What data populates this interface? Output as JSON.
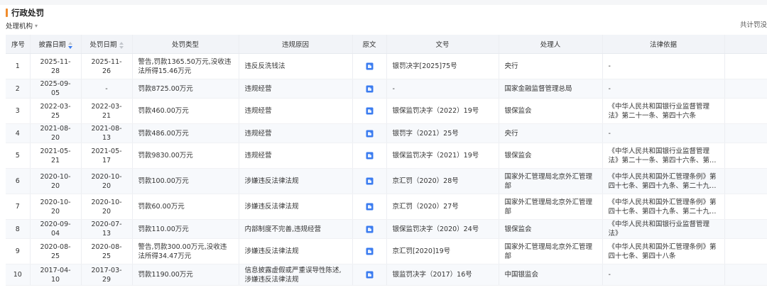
{
  "section": {
    "title": "行政处罚"
  },
  "filter": {
    "label": "处理机构"
  },
  "total_text": "共计罚没",
  "columns": {
    "idx": "序号",
    "disclose_date": "披露日期",
    "penalty_date": "处罚日期",
    "penalty_type": "处罚类型",
    "reason": "违规原因",
    "original": "原文",
    "doc_no": "文号",
    "handler": "处理人",
    "law": "法律依据"
  },
  "rows": [
    {
      "idx": "1",
      "disclose_date": "2025-11-28",
      "penalty_date": "2025-11-26",
      "penalty_type": "警告,罚款1365.50万元,没收违法所得15.46万元",
      "reason": "违反反洗钱法",
      "doc_no": "银罚决字[2025]75号",
      "handler": "央行",
      "law": "-"
    },
    {
      "idx": "2",
      "disclose_date": "2025-09-05",
      "penalty_date": "-",
      "penalty_type": "罚款8725.00万元",
      "reason": "违规经营",
      "doc_no": "-",
      "handler": "国家金融监督管理总局",
      "law": "-"
    },
    {
      "idx": "3",
      "disclose_date": "2022-03-25",
      "penalty_date": "2022-03-21",
      "penalty_type": "罚款460.00万元",
      "reason": "违规经营",
      "doc_no": "银保监罚决字（2022）19号",
      "handler": "银保监会",
      "law": "《中华人民共和国银行业监督管理法》第二十一条、第四十六条"
    },
    {
      "idx": "4",
      "disclose_date": "2021-08-20",
      "penalty_date": "2021-08-13",
      "penalty_type": "罚款486.00万元",
      "reason": "违规经营",
      "doc_no": "银罚字（2021）25号",
      "handler": "央行",
      "law": "-"
    },
    {
      "idx": "5",
      "disclose_date": "2021-05-21",
      "penalty_date": "2021-05-17",
      "penalty_type": "罚款9830.00万元",
      "reason": "违规经营",
      "doc_no": "银保监罚决字（2021）19号",
      "handler": "银保监会",
      "law": "《中华人民共和国银行业监督管理法》第二十一条、第四十六条、第四十七条"
    },
    {
      "idx": "6",
      "disclose_date": "2020-10-20",
      "penalty_date": "2020-10-20",
      "penalty_type": "罚款100.00万元",
      "reason": "涉嫌违反法律法规",
      "doc_no": "京汇罚（2020）28号",
      "handler": "国家外汇管理局北京外汇管理部",
      "law": "《中华人民共和国外汇管理条例》第四十七条、第四十九条、第二十九条、《关于调整..."
    },
    {
      "idx": "7",
      "disclose_date": "2020-10-20",
      "penalty_date": "2020-10-20",
      "penalty_type": "罚款60.00万元",
      "reason": "涉嫌违反法律法规",
      "doc_no": "京汇罚（2020）27号",
      "handler": "国家外汇管理局北京外汇管理部",
      "law": "《中华人民共和国外汇管理条例》第四十七条、第四十九条、第二十九条、《关于调整..."
    },
    {
      "idx": "8",
      "disclose_date": "2020-09-04",
      "penalty_date": "2020-07-13",
      "penalty_type": "罚款110.00万元",
      "reason": "内部制度不完善,违规经营",
      "doc_no": "银保监罚决字（2020）24号",
      "handler": "银保监会",
      "law": "《中华人民共和国银行业监督管理法》"
    },
    {
      "idx": "9",
      "disclose_date": "2020-08-25",
      "penalty_date": "2020-08-25",
      "penalty_type": "警告,罚款300.00万元,没收违法所得34.47万元",
      "reason": "涉嫌违反法律法规",
      "doc_no": "京汇罚[2020]19号",
      "handler": "国家外汇管理局北京外汇管理部",
      "law": "《中华人民共和国外汇管理条例》第四十七条、第四十八条"
    },
    {
      "idx": "10",
      "disclose_date": "2017-04-10",
      "penalty_date": "2017-03-29",
      "penalty_type": "罚款1190.00万元",
      "reason": "信息披露虚假或严重误导性陈述,涉嫌违反法律法规",
      "doc_no": "银监罚决字（2017）16号",
      "handler": "中国银监会",
      "law": "-"
    }
  ],
  "colors": {
    "accent": "#f08c2d",
    "header_bg": "#f2f4f8",
    "sort_active": "#3b7cf0",
    "doc_icon": "#3b7cf0"
  },
  "icons": {
    "doc": "document-icon",
    "sort": "sort-icon",
    "filter": "caret-down-icon"
  }
}
